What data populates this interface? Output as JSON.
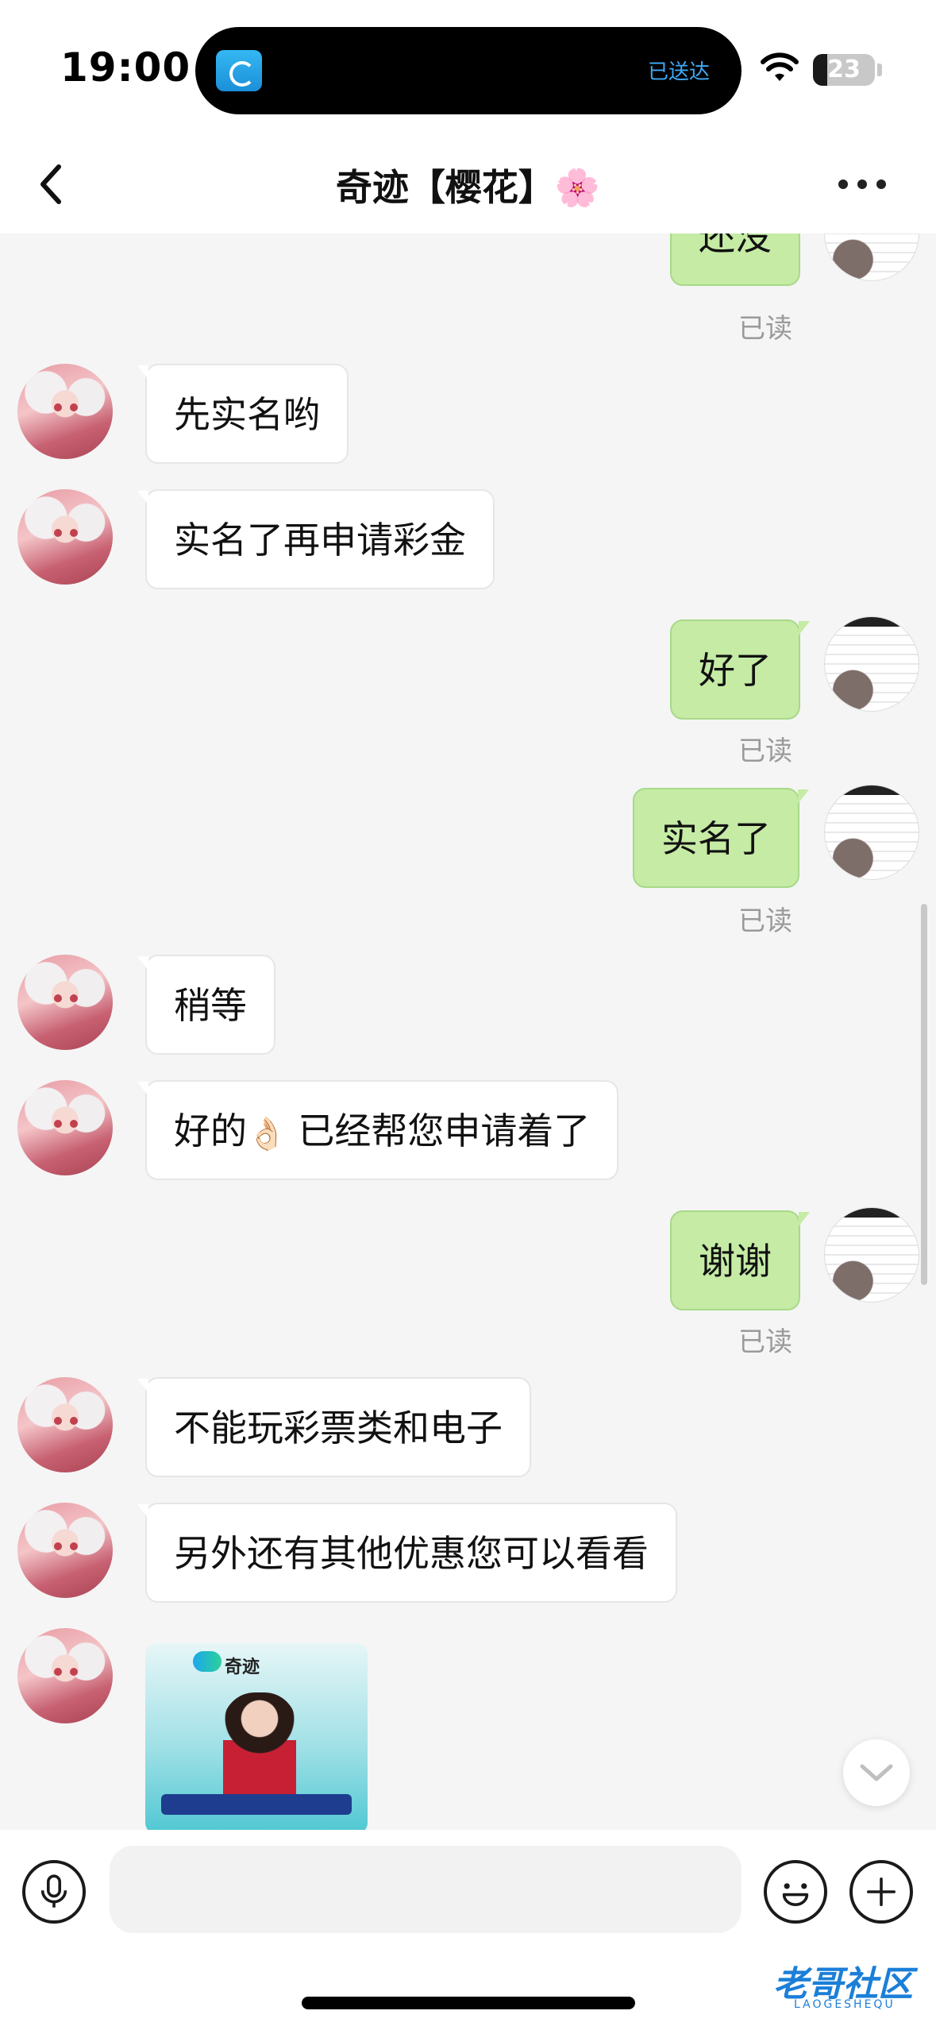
{
  "status_bar": {
    "time": "19:00",
    "island_status": "已送达",
    "battery": "23",
    "battery_level_percent": 23
  },
  "nav": {
    "title": "奇迹【樱花】🌸"
  },
  "messages": [
    {
      "side": "right",
      "text": "还没",
      "read": "已读"
    },
    {
      "side": "left",
      "text": "先实名哟"
    },
    {
      "side": "left",
      "text": "实名了再申请彩金"
    },
    {
      "side": "right",
      "text": "好了",
      "read": "已读"
    },
    {
      "side": "right",
      "text": "实名了",
      "read": "已读"
    },
    {
      "side": "left",
      "text": "稍等"
    },
    {
      "side": "left",
      "text_before": "好的",
      "emoji": "👌🏻",
      "text_after": " 已经帮您申请着了"
    },
    {
      "side": "right",
      "text": "谢谢",
      "read": "已读"
    },
    {
      "side": "left",
      "text": "不能玩彩票类和电子"
    },
    {
      "side": "left",
      "text": "另外还有其他优惠您可以看看"
    },
    {
      "side": "left",
      "type": "image",
      "brand": "奇迹"
    }
  ],
  "input": {
    "placeholder": ""
  },
  "watermark": {
    "title": "老哥社区",
    "subtitle": "LAOGESHEQU"
  },
  "colors": {
    "outgoing_bubble": "#c5eba5",
    "incoming_bubble": "#ffffff",
    "background": "#f5f5f5",
    "island_status": "#3fa9f5"
  }
}
